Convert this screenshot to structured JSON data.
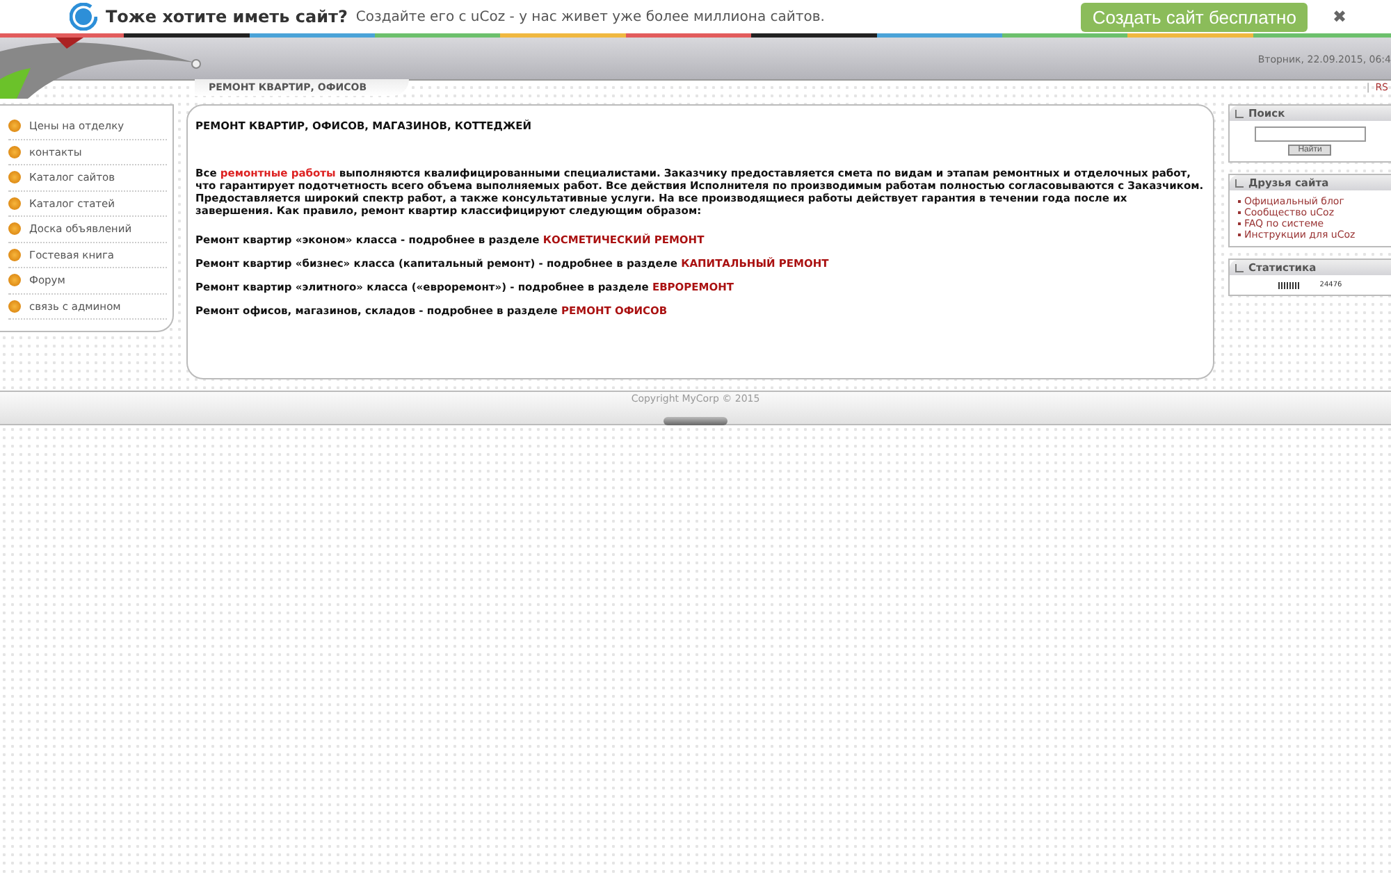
{
  "promo_bar": {
    "title": "Тоже хотите иметь сайт?",
    "text": "Создайте его с uCoz -  у нас живет уже более миллиона сайтов.",
    "button": "Создать сайт бесплатно",
    "close": "✖"
  },
  "header": {
    "tagline": "РЕМОНТ КВАРТИР, ОФИСОВ",
    "date": "Вторник, 22.09.2015, 06:4",
    "rss_separator": "|",
    "rss": "RS"
  },
  "menu": [
    {
      "label": "Цены на отделку"
    },
    {
      "label": "контакты"
    },
    {
      "label": "Каталог сайтов"
    },
    {
      "label": "Каталог статей"
    },
    {
      "label": "Доска объявлений"
    },
    {
      "label": "Гостевая книга"
    },
    {
      "label": "Форум"
    },
    {
      "label": "связь с админом"
    }
  ],
  "content": {
    "heading": "РЕМОНТ КВАРТИР, ОФИСОВ, МАГАЗИНОВ, КОТТЕДЖЕЙ",
    "intro": {
      "before": "Все ",
      "link": "ремонтные работы",
      "after": " выполняются квалифицированными специалистами. Заказчику предоставляется смета по видам и этапам ремонтных и отделочных работ, что гарантирует подотчетность всего объема выполняемых работ. Все действия Исполнителя по производимым работам полностью согласовываются с Заказчиком. Предоставляется широкий спектр работ, а также консультативные услуги. На все производящиеся работы действует гарантия в течении года после их завершения. Как правило, ремонт квартир классифицируют следующим образом:"
    },
    "items": [
      {
        "text": "Ремонт квартир «эконом» класса - подробнее в разделе ",
        "link": "КОСМЕТИЧЕСКИЙ РЕМОНТ"
      },
      {
        "text": "Ремонт квартир «бизнес» класса (капитальный ремонт) - подробнее в разделе ",
        "link": "КАПИТАЛЬНЫЙ РЕМОНТ"
      },
      {
        "text": "Ремонт квартир «элитного» класса («евроремонт») - подробнее в разделе ",
        "link": "ЕВРОРЕМОНТ"
      },
      {
        "text": "Ремонт офисов, магазинов, складов - подробнее в разделе ",
        "link": "РЕМОНТ ОФИСОВ"
      }
    ]
  },
  "sidebar": {
    "search": {
      "title": "Поиск",
      "button": "Найти"
    },
    "friends": {
      "title": "Друзья сайта",
      "links": [
        "Официальный блог",
        "Сообщество uCoz",
        "FAQ по системе",
        "Инструкции для uCoz"
      ]
    },
    "stats": {
      "title": "Статистика",
      "counter": "24476"
    }
  },
  "footer": {
    "copyright": "Copyright MyCorp © 2015"
  }
}
